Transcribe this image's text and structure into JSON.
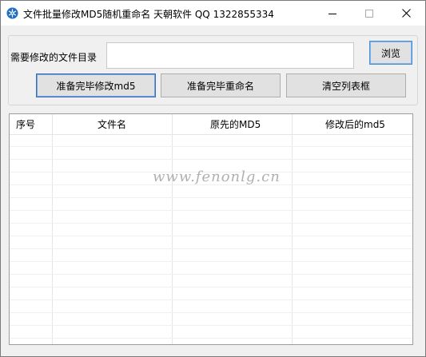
{
  "window": {
    "title": "文件批量修改MD5随机重命名 天朝软件 QQ 1322855334",
    "icon": "gear-snowflake-icon",
    "controls": {
      "minimize": "minimize-icon",
      "maximize": "maximize-icon",
      "close": "close-icon"
    }
  },
  "form": {
    "dir_label": "需要修改的文件目录",
    "dir_value": "",
    "browse_label": "浏览",
    "md5_button_label": "准备完毕修改md5",
    "rename_button_label": "准备完毕重命名",
    "clear_button_label": "清空列表框"
  },
  "list": {
    "columns": [
      "序号",
      "文件名",
      "原先的MD5",
      "修改后的md5"
    ],
    "rows": []
  },
  "watermark": "www.fenonlg.cn",
  "colors": {
    "accent_border": "#3c6fb8",
    "button_face": "#e1e1e1",
    "window_bg": "#f0f0f0"
  }
}
